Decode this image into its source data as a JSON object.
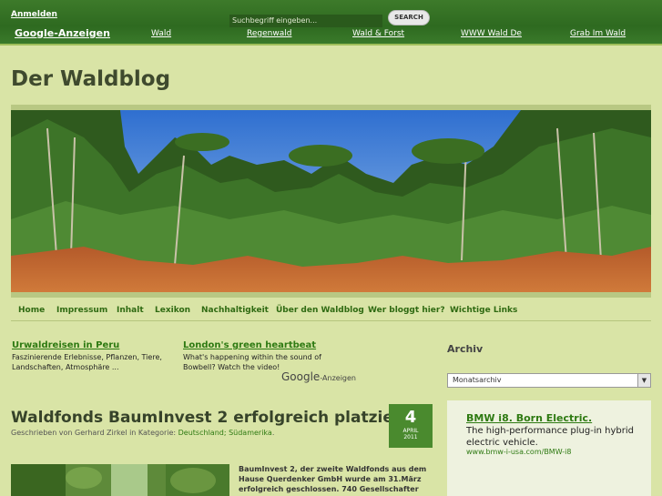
{
  "topbar": {
    "login": "Anmelden",
    "search_placeholder": "Suchbegriff eingeben...",
    "search_button": "SEARCH",
    "ads_label": "Google-Anzeigen",
    "links": [
      "Wald",
      "Regenwald",
      "Wald & Forst",
      "WWW Wald De",
      "Grab Im Wald"
    ]
  },
  "site": {
    "title": "Der Waldblog"
  },
  "nav": {
    "items": [
      "Home",
      "Impressum",
      "Inhalt",
      "Lexikon",
      "Nachhaltigkeit",
      "Über den Waldblog",
      "Wer bloggt hier?",
      "Wichtige Links"
    ]
  },
  "ads": [
    {
      "title": "Urwaldreisen in Peru",
      "desc": "Faszinierende Erlebnisse, Pflanzen, Tiere, Landschaften, Atmosphäre ..."
    },
    {
      "title": "London's green heartbeat",
      "desc": "What's happening within the sound of Bowbell? Watch the video!"
    }
  ],
  "google_ads": {
    "brand": "Google",
    "suffix": "-Anzeigen"
  },
  "post": {
    "title": "Waldfonds BaumInvest 2 erfolgreich platziert!",
    "meta_prefix": "Geschrieben von Gerhard Zirkel in Kategorie: ",
    "categories": "Deutschland; Südamerika",
    "meta_suffix": ".",
    "date": {
      "day": "4",
      "month": "APRIL",
      "year": "2011"
    },
    "excerpt": "BaumInvest 2, der zweite Waldfonds aus dem Hause Querdenker GmbH wurde am 31.März erfolgreich geschlossen. 740 Gesellschafter"
  },
  "sidebar": {
    "archive_title": "Archiv",
    "archive_select": "Monatsarchiv",
    "ad": {
      "title": "BMW i8. Born Electric.",
      "desc": "The high-performance plug-in hybrid electric vehicle.",
      "url": "www.bmw-i-usa.com/BMW-i8"
    }
  }
}
